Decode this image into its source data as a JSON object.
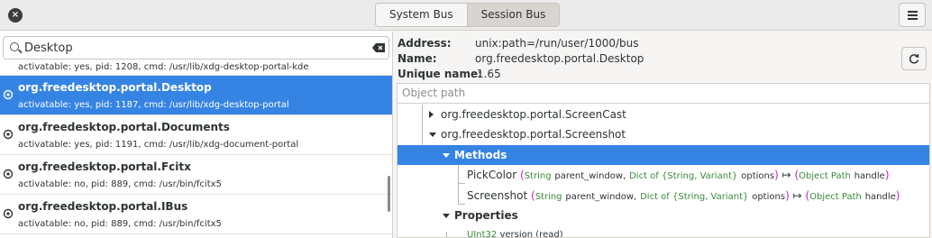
{
  "header": {
    "close_label": "×",
    "tabs": [
      {
        "label": "System Bus",
        "active": false
      },
      {
        "label": "Session Bus",
        "active": true
      }
    ]
  },
  "search": {
    "value": "Desktop"
  },
  "services": [
    {
      "name": "",
      "detail": "activatable: yes, pid: 1208, cmd: /usr/lib/xdg-desktop-portal-kde"
    },
    {
      "name": "org.freedesktop.portal.Desktop",
      "detail": "activatable: yes, pid: 1187, cmd: /usr/lib/xdg-desktop-portal",
      "selected": true
    },
    {
      "name": "org.freedesktop.portal.Documents",
      "detail": "activatable: yes, pid: 1191, cmd: /usr/lib/xdg-document-portal"
    },
    {
      "name": "org.freedesktop.portal.Fcitx",
      "detail": "activatable: no, pid: 889, cmd: /usr/bin/fcitx5"
    },
    {
      "name": "org.freedesktop.portal.IBus",
      "detail": "activatable: no, pid: 889, cmd: /usr/bin/fcitx5"
    }
  ],
  "info": {
    "address_label": "Address:",
    "address": "unix:path=/run/user/1000/bus",
    "name_label": "Name:",
    "name": "org.freedesktop.portal.Desktop",
    "unique_label": "Unique name:",
    "unique": ":1.65"
  },
  "tree": {
    "header": "Object path",
    "nodes": {
      "screencast": "org.freedesktop.portal.ScreenCast",
      "screenshot": "org.freedesktop.portal.Screenshot",
      "methods": "Methods",
      "properties": "Properties"
    },
    "pickcolor": {
      "name": "PickColor",
      "open": "(",
      "t1": "String",
      "p1": "parent_window,",
      "t2": "Dict of {String, Variant}",
      "p2": "options",
      "close": ")",
      "arrow": "↦",
      "ropen": "(",
      "rt": "Object Path",
      "rp": "handle",
      "rclose": ")"
    },
    "screenshotm": {
      "name": "Screenshot",
      "open": "(",
      "t1": "String",
      "p1": "parent_window,",
      "t2": "Dict of {String, Variant}",
      "p2": "options",
      "close": ")",
      "arrow": "↦",
      "ropen": "(",
      "rt": "Object Path",
      "rp": "handle",
      "rclose": ")"
    },
    "property": {
      "type": "UInt32",
      "name": "version",
      "access": "(read)"
    }
  },
  "colors": {
    "accent": "#3584e4",
    "type": "#3a8a3a",
    "paren": "#c61ed1"
  }
}
